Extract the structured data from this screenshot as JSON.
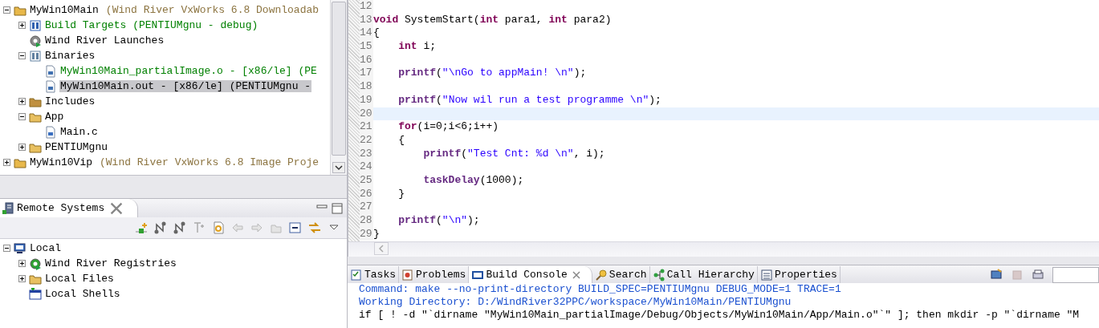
{
  "project_tree": {
    "items": [
      {
        "kind": "project",
        "label": "MyWin10Main",
        "color": "#000000",
        "detail": "(Wind River VxWorks 6.8 Downloadab",
        "expanded": true,
        "selected": false,
        "children": [
          {
            "kind": "build-targets",
            "label": "Build Targets (PENTIUMgnu - debug)",
            "color": "#008000",
            "expanded": false,
            "selected": false
          },
          {
            "kind": "launches",
            "label": "Wind River Launches",
            "color": "#000000",
            "selected": false
          },
          {
            "kind": "binaries",
            "label": "Binaries",
            "color": "#000000",
            "expanded": true,
            "selected": false,
            "children": [
              {
                "kind": "binary",
                "label": "MyWin10Main_partialImage.o - [x86/le] (PE",
                "color": "#008000",
                "selected": false
              },
              {
                "kind": "binary",
                "label": "MyWin10Main.out - [x86/le] (PENTIUMgnu -",
                "color": "#000000",
                "selected": true
              }
            ]
          },
          {
            "kind": "includes",
            "label": "Includes",
            "color": "#000000",
            "expanded": false,
            "selected": false
          },
          {
            "kind": "folder",
            "label": "App",
            "color": "#000000",
            "expanded": true,
            "selected": false,
            "children": [
              {
                "kind": "c-file",
                "label": "Main.c",
                "color": "#000000",
                "selected": false
              }
            ]
          },
          {
            "kind": "folder",
            "label": "PENTIUMgnu",
            "color": "#000000",
            "expanded": false,
            "selected": false
          }
        ]
      },
      {
        "kind": "project",
        "label": "MyWin10Vip",
        "color": "#000000",
        "detail": "(Wind River VxWorks 6.8 Image Proje",
        "expanded": false,
        "selected": false
      }
    ]
  },
  "remote_systems": {
    "title": "Remote Systems",
    "items": [
      {
        "kind": "local",
        "label": "Local",
        "color": "#000000",
        "expanded": true,
        "selected": false,
        "children": [
          {
            "kind": "registries",
            "label": "Wind River Registries",
            "color": "#000000",
            "expanded": false,
            "selected": false
          },
          {
            "kind": "files",
            "label": "Local Files",
            "color": "#000000",
            "expanded": false,
            "selected": false
          },
          {
            "kind": "shells",
            "label": "Local Shells",
            "color": "#000000",
            "selected": false
          }
        ]
      }
    ]
  },
  "editor": {
    "lines": [
      {
        "number": "12",
        "current": false
      },
      {
        "number": "13",
        "current": false,
        "tokens": [
          {
            "kind": "keyword",
            "text": "void"
          },
          {
            "kind": "plain",
            "text": " SystemStart("
          },
          {
            "kind": "keyword",
            "text": "int"
          },
          {
            "kind": "plain",
            "text": " para1, "
          },
          {
            "kind": "keyword",
            "text": "int"
          },
          {
            "kind": "plain",
            "text": " para2)"
          }
        ]
      },
      {
        "number": "14",
        "current": false,
        "tokens": [
          {
            "kind": "plain",
            "text": "{"
          }
        ]
      },
      {
        "number": "15",
        "current": false,
        "tokens": [
          {
            "kind": "keyword",
            "text": "    int"
          },
          {
            "kind": "plain",
            "text": " i;"
          }
        ]
      },
      {
        "number": "16",
        "current": false
      },
      {
        "number": "17",
        "current": false,
        "tokens": [
          {
            "kind": "function",
            "text": "    printf"
          },
          {
            "kind": "plain",
            "text": "("
          },
          {
            "kind": "string",
            "text": "\"\\nGo to appMain! \\n\""
          },
          {
            "kind": "plain",
            "text": ");"
          }
        ]
      },
      {
        "number": "18",
        "current": false
      },
      {
        "number": "19",
        "current": false,
        "tokens": [
          {
            "kind": "function",
            "text": "    printf"
          },
          {
            "kind": "plain",
            "text": "("
          },
          {
            "kind": "string",
            "text": "\"Now wil run a test programme \\n\""
          },
          {
            "kind": "plain",
            "text": ");"
          }
        ]
      },
      {
        "number": "20",
        "current": true
      },
      {
        "number": "21",
        "current": false,
        "tokens": [
          {
            "kind": "keyword",
            "text": "    for"
          },
          {
            "kind": "plain",
            "text": "(i=0;i<6;i++)"
          }
        ]
      },
      {
        "number": "22",
        "current": false,
        "tokens": [
          {
            "kind": "plain",
            "text": "    {"
          }
        ]
      },
      {
        "number": "23",
        "current": false,
        "tokens": [
          {
            "kind": "function",
            "text": "        printf"
          },
          {
            "kind": "plain",
            "text": "("
          },
          {
            "kind": "string",
            "text": "\"Test Cnt: %d \\n\""
          },
          {
            "kind": "plain",
            "text": ", i);"
          }
        ]
      },
      {
        "number": "24",
        "current": false
      },
      {
        "number": "25",
        "current": false,
        "tokens": [
          {
            "kind": "function",
            "text": "        taskDelay"
          },
          {
            "kind": "plain",
            "text": "(1000);"
          }
        ]
      },
      {
        "number": "26",
        "current": false,
        "tokens": [
          {
            "kind": "plain",
            "text": "    }"
          }
        ]
      },
      {
        "number": "27",
        "current": false
      },
      {
        "number": "28",
        "current": false,
        "tokens": [
          {
            "kind": "function",
            "text": "    printf"
          },
          {
            "kind": "plain",
            "text": "("
          },
          {
            "kind": "string",
            "text": "\"\\n\""
          },
          {
            "kind": "plain",
            "text": ");"
          }
        ]
      },
      {
        "number": "29",
        "current": false,
        "tokens": [
          {
            "kind": "plain",
            "text": "}"
          }
        ]
      }
    ]
  },
  "console": {
    "tabs": [
      {
        "kind": "tasks",
        "label": "Tasks",
        "selected": false
      },
      {
        "kind": "problems",
        "label": "Problems",
        "selected": false
      },
      {
        "kind": "console",
        "label": "Build Console",
        "selected": true
      },
      {
        "kind": "search",
        "label": "Search",
        "selected": false
      },
      {
        "kind": "hierarchy",
        "label": "Call Hierarchy",
        "selected": false
      },
      {
        "kind": "properties",
        "label": "Properties",
        "selected": false
      }
    ],
    "lines": [
      {
        "kind": "info",
        "text": "Command: make --no-print-directory BUILD_SPEC=PENTIUMgnu DEBUG_MODE=1 TRACE=1"
      },
      {
        "kind": "info",
        "text": "Working Directory: D:/WindRiver32PPC/workspace/MyWin10Main/PENTIUMgnu"
      },
      {
        "kind": "output",
        "text": "if [ ! -d \"`dirname \"MyWin10Main_partialImage/Debug/Objects/MyWin10Main/App/Main.o\"`\" ]; then mkdir -p \"`dirname \"M"
      }
    ]
  }
}
